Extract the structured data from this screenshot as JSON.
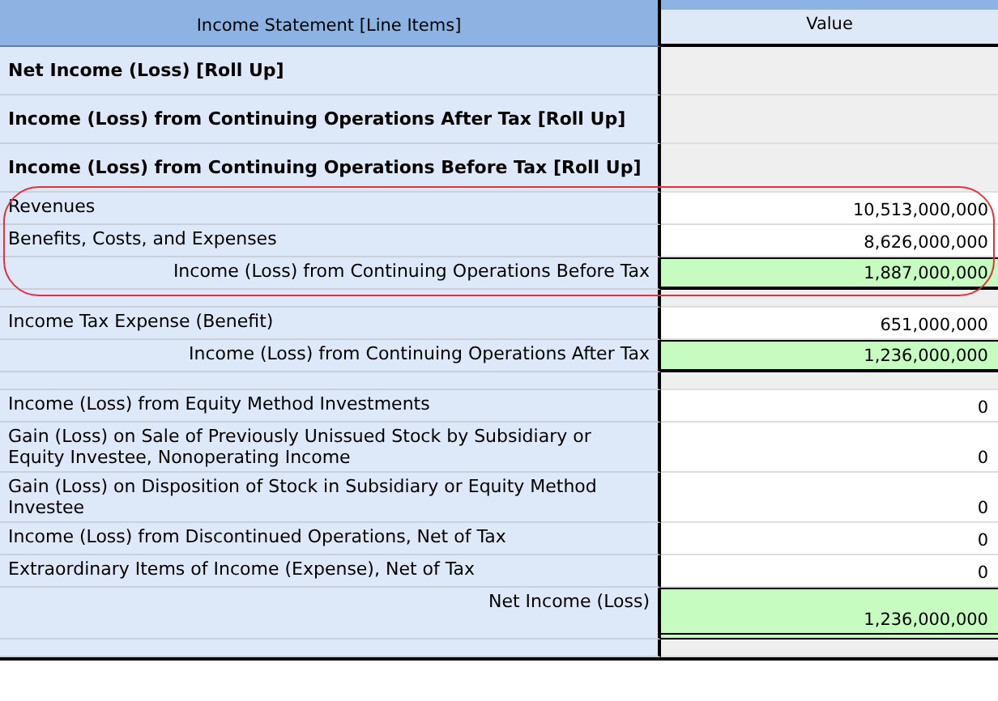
{
  "table": {
    "columns": [
      "Income Statement [Line Items]",
      "Value"
    ],
    "row_groups": [
      {
        "highlighted": false,
        "rows": [
          {
            "kind": "heading",
            "label": "Net Income (Loss) [Roll Up]"
          },
          {
            "kind": "heading",
            "label": "Income (Loss) from Continuing Operations After Tax [Roll Up]"
          },
          {
            "kind": "heading",
            "label": "Income (Loss) from Continuing Operations Before Tax [Roll Up]"
          }
        ]
      },
      {
        "highlighted": true,
        "rows": [
          {
            "kind": "item",
            "label": "Revenues",
            "value": "10,513,000,000"
          },
          {
            "kind": "item",
            "label": "Benefits, Costs, and Expenses",
            "value": "8,626,000,000"
          },
          {
            "kind": "total",
            "label": "Income (Loss) from Continuing Operations Before Tax",
            "value": "1,887,000,000"
          }
        ]
      },
      {
        "highlighted": false,
        "rows": [
          {
            "kind": "spacer"
          },
          {
            "kind": "item",
            "label": "Income Tax Expense (Benefit)",
            "value": "651,000,000"
          },
          {
            "kind": "total",
            "label": "Income (Loss) from Continuing Operations After Tax",
            "value": "1,236,000,000"
          },
          {
            "kind": "spacer"
          },
          {
            "kind": "item",
            "label": "Income (Loss) from Equity Method Investments",
            "value": "0"
          },
          {
            "kind": "item",
            "label": "Gain (Loss) on Sale of Previously Unissued Stock by Subsidiary or Equity Investee, Nonoperating Income",
            "value": "0"
          },
          {
            "kind": "item",
            "label": "Gain (Loss) on Disposition of Stock in Subsidiary or Equity Method Investee",
            "value": "0"
          },
          {
            "kind": "item",
            "label": "Income (Loss) from Discontinued Operations, Net of Tax",
            "value": "0"
          },
          {
            "kind": "item",
            "label": "Extraordinary Items of Income (Expense), Net of Tax",
            "value": "0"
          },
          {
            "kind": "grand_total",
            "label": "Net Income (Loss)",
            "value": "1,236,000,000"
          },
          {
            "kind": "spacer"
          }
        ]
      }
    ]
  }
}
